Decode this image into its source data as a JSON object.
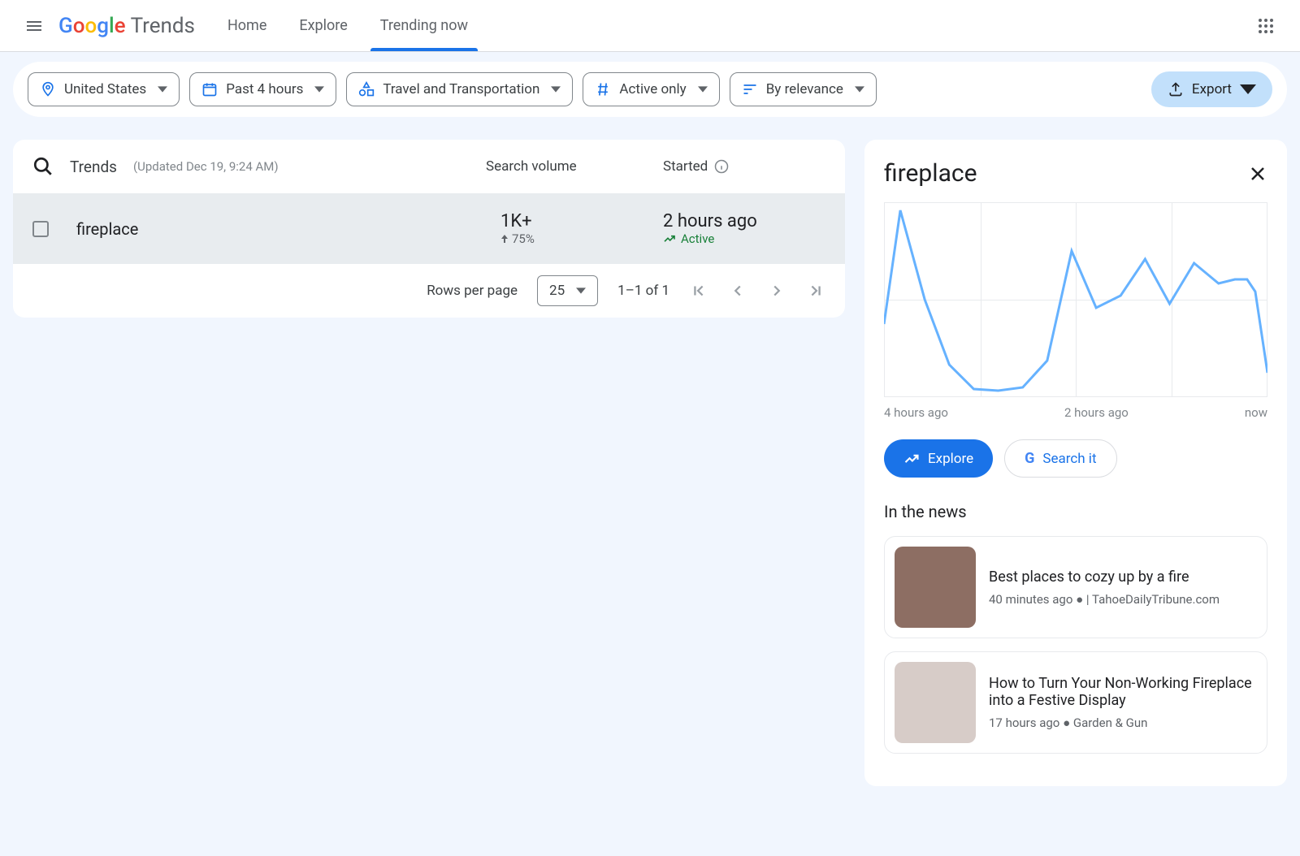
{
  "header": {
    "brand": "Trends",
    "tabs": {
      "home": "Home",
      "explore": "Explore",
      "trending": "Trending now"
    }
  },
  "filters": {
    "region": "United States",
    "timeframe": "Past 4 hours",
    "category": "Travel and Transportation",
    "status": "Active only",
    "sort": "By relevance",
    "export": "Export"
  },
  "table": {
    "header": {
      "trends_label": "Trends",
      "updated": "(Updated Dec 19, 9:24 AM)",
      "volume_label": "Search volume",
      "started_label": "Started"
    },
    "rows": [
      {
        "term": "fireplace",
        "volume": "1K+",
        "delta": "75%",
        "started": "2 hours ago",
        "status": "Active"
      }
    ],
    "pager": {
      "rows_per_page_label": "Rows per page",
      "rows_per_page_value": "25",
      "range": "1–1 of 1"
    }
  },
  "detail": {
    "title": "fireplace",
    "xaxis": {
      "left": "4 hours ago",
      "mid": "2 hours ago",
      "right": "now"
    },
    "explore": "Explore",
    "search": "Search it",
    "news_title": "In the news",
    "news": [
      {
        "headline": "Best places to cozy up by a fire",
        "meta": "40 minutes ago ● | TahoeDailyTribune.com"
      },
      {
        "headline": "How to Turn Your Non-Working Fireplace into a Festive Display",
        "meta": "17 hours ago ● Garden & Gun"
      }
    ]
  },
  "chart_data": {
    "type": "line",
    "title": "fireplace",
    "xlabel": "",
    "ylabel": "",
    "x_ticks": [
      "4 hours ago",
      "2 hours ago",
      "now"
    ],
    "ylim": [
      0,
      100
    ],
    "series": [
      {
        "name": "fireplace",
        "values": [
          40,
          100,
          55,
          18,
          5,
          4,
          6,
          20,
          78,
          48,
          55,
          75,
          50,
          72,
          60,
          62,
          62,
          55,
          15
        ]
      }
    ]
  }
}
